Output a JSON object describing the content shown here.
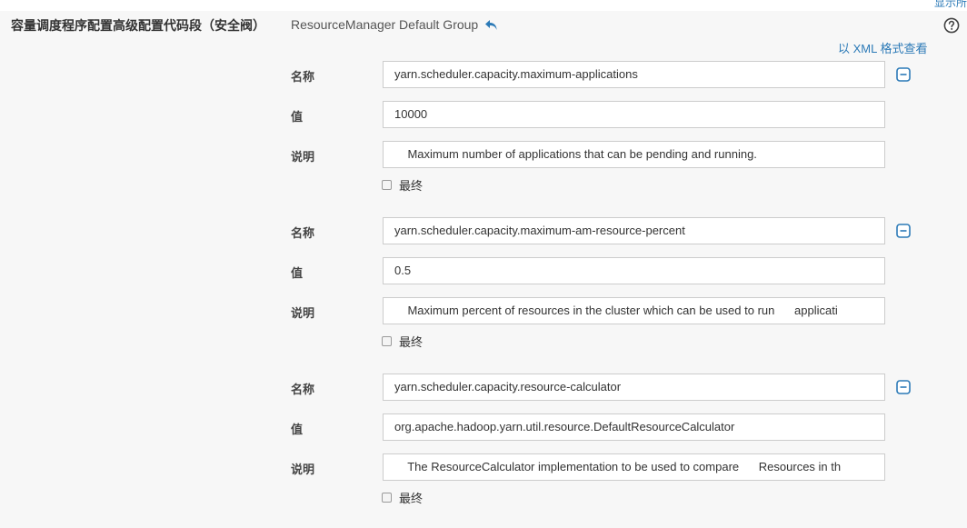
{
  "header": {
    "corner_text": "显示所",
    "section_label": "容量调度程序配置高级配置代码段（安全阀）",
    "group_label": "ResourceManager Default Group",
    "xml_link": "以 XML 格式查看"
  },
  "icons": {
    "undo": "undo-arrow-icon",
    "help": "question-circle-icon",
    "remove": "minus-square-icon"
  },
  "colors": {
    "accent": "#2c7ab7",
    "background": "#f7f7f7",
    "field_border": "#cccccc"
  },
  "labels": {
    "name": "名称",
    "value": "值",
    "description": "说明",
    "final": "最终"
  },
  "entries": [
    {
      "name": "yarn.scheduler.capacity.maximum-applications",
      "value": "10000",
      "description": "    Maximum number of applications that can be pending and running.",
      "final": false
    },
    {
      "name": "yarn.scheduler.capacity.maximum-am-resource-percent",
      "value": "0.5",
      "description": "    Maximum percent of resources in the cluster which can be used to run      applicati",
      "final": false
    },
    {
      "name": "yarn.scheduler.capacity.resource-calculator",
      "value": "org.apache.hadoop.yarn.util.resource.DefaultResourceCalculator",
      "description": "    The ResourceCalculator implementation to be used to compare      Resources in th",
      "final": false
    }
  ]
}
